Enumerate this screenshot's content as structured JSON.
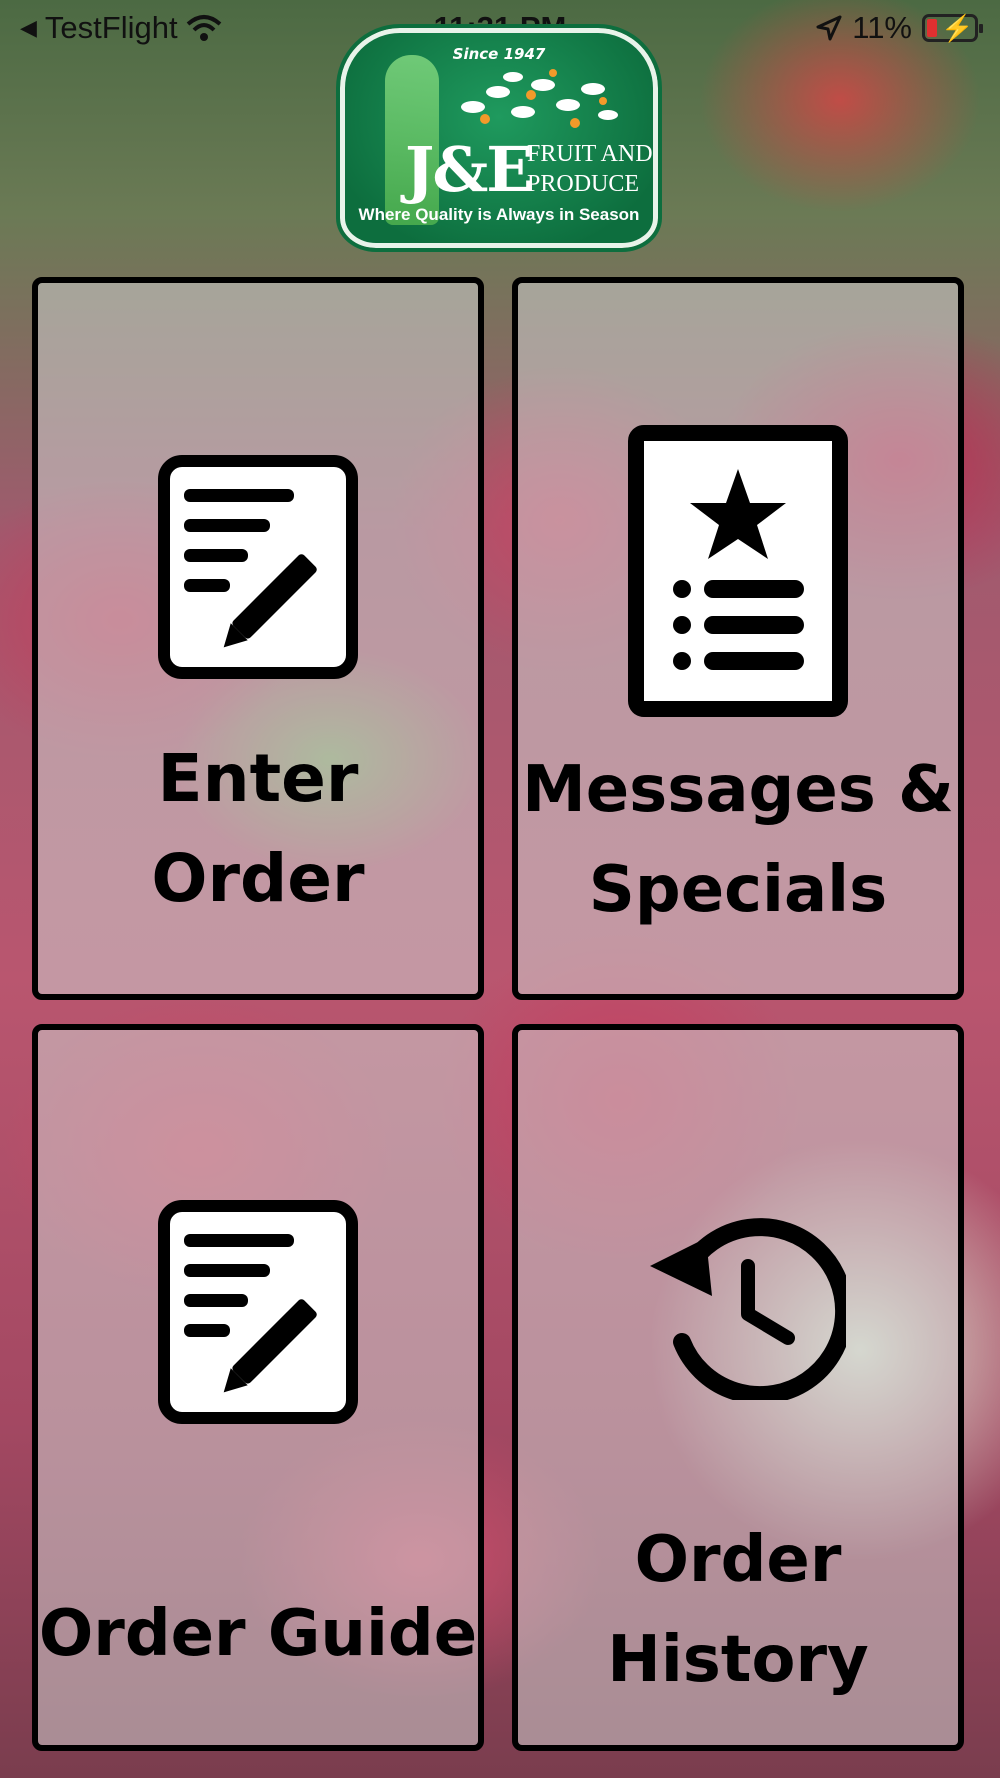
{
  "status_bar": {
    "back_label": "TestFlight",
    "time": "11:31 PM",
    "battery": "11%"
  },
  "logo": {
    "since": "Since 1947",
    "brand": "J&E",
    "name_line1": "FRUIT AND",
    "name_line2": "PRODUCE",
    "tagline": "Where Quality is Always in Season"
  },
  "tiles": [
    {
      "line1": "Enter",
      "line2": "Order",
      "icon": "edit-document-icon"
    },
    {
      "line1": "Messages &",
      "line2": "Specials",
      "icon": "featured-list-icon"
    },
    {
      "line1": "Order Guide",
      "icon": "edit-document-icon"
    },
    {
      "line1": "Order",
      "line2": "History",
      "icon": "history-icon"
    }
  ]
}
